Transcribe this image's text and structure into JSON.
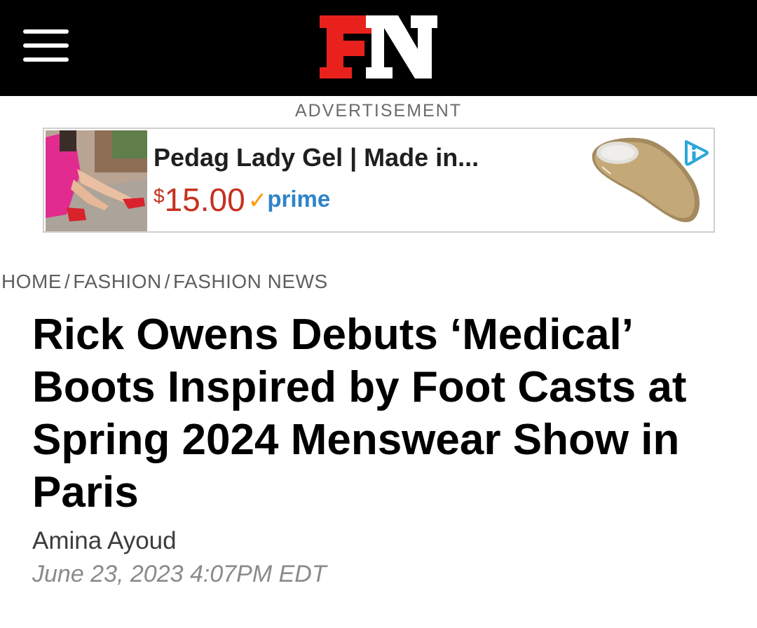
{
  "header": {
    "logo_text": "FN",
    "menu_icon": "hamburger-menu-icon"
  },
  "advertisement": {
    "label": "ADVERTISEMENT",
    "title": "Pedag Lady Gel | Made in...",
    "price_symbol": "$",
    "price_amount": "15.00",
    "prime_label": "prime",
    "adchoices_icon": "adchoices-icon",
    "colors": {
      "price": "#c6311e",
      "prime": "#2f84c8",
      "check": "#ff9900"
    }
  },
  "breadcrumb": {
    "items": [
      "HOME",
      "FASHION",
      "FASHION NEWS"
    ],
    "separator": "/"
  },
  "article": {
    "headline": "Rick Owens Debuts ‘Medical’ Boots Inspired by Foot Casts at Spring 2024 Menswear Show in Paris",
    "author": "Amina Ayoud",
    "date": "June 23, 2023 4:07PM EDT"
  },
  "colors": {
    "brand_red": "#e8211d",
    "header_bg": "#000000"
  }
}
